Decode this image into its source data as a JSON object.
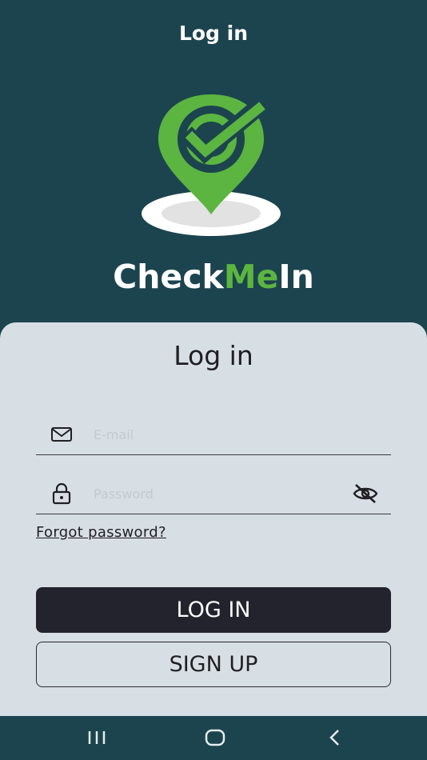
{
  "app_bar": {
    "title": "Log in"
  },
  "brand": {
    "part1": "Check",
    "part2": "Me",
    "part3": "In"
  },
  "colors": {
    "background": "#1c444e",
    "accent": "#5bb540",
    "card": "#d8dfe4",
    "primary_button": "#23232d"
  },
  "form": {
    "title": "Log in",
    "email": {
      "placeholder": "E-mail",
      "value": "",
      "icon": "mail-icon"
    },
    "password": {
      "placeholder": "Password",
      "value": "",
      "icon": "lock-icon",
      "toggle_icon": "eye-off-icon"
    },
    "forgot_label": "Forgot password?",
    "login_label": "LOG IN",
    "signup_label": "SIGN UP"
  },
  "navbar": {
    "items": [
      "recent-apps-icon",
      "home-icon",
      "back-icon"
    ]
  }
}
